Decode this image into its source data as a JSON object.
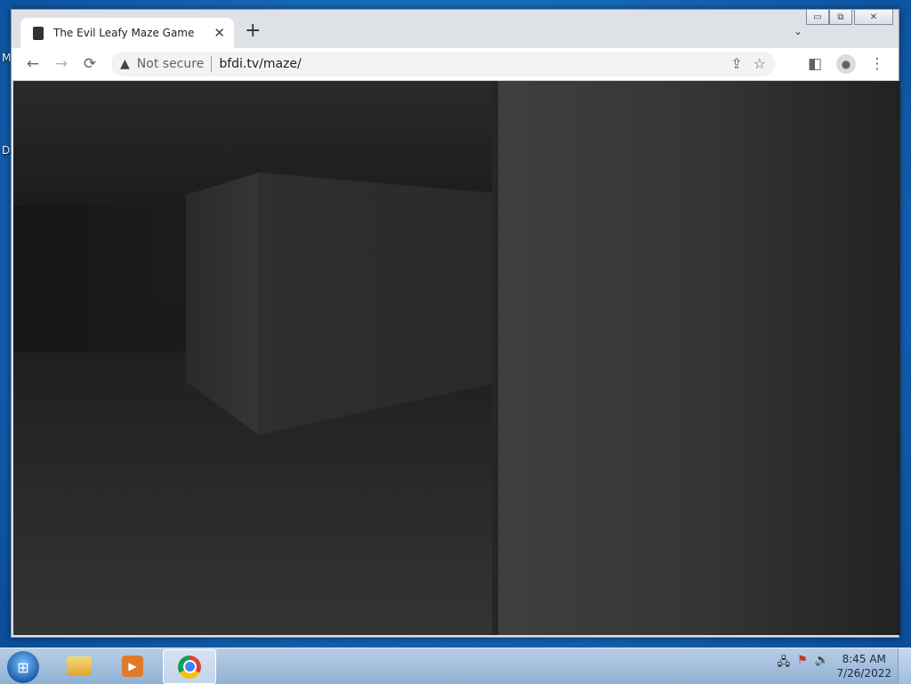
{
  "desktop": {
    "labels": [
      "M",
      "D"
    ]
  },
  "browser": {
    "tab": {
      "title": "The Evil Leafy Maze Game",
      "close": "✕"
    },
    "new_tab": "+",
    "tab_search": "⌄",
    "caption": {
      "minimize": "▭",
      "restore": "⧉",
      "close": "✕"
    },
    "nav": {
      "back": "←",
      "forward": "→",
      "reload": "⟳"
    },
    "omnibox": {
      "warning_icon": "▲",
      "security_label": "Not secure",
      "url": "bfdi.tv/maze/",
      "share": "⇪",
      "bookmark": "☆"
    },
    "sidepanel": "◧",
    "profile": "●",
    "menu": "⋮"
  },
  "taskbar": {
    "start": "⊞",
    "apps": [
      {
        "name": "windows-explorer",
        "active": false
      },
      {
        "name": "windows-media-player",
        "active": false,
        "glyph": "▶"
      },
      {
        "name": "google-chrome",
        "active": true
      }
    ],
    "tray": {
      "network": "🖧",
      "flag": "⚑",
      "volume": "🔊"
    },
    "clock": {
      "time": "8:45 AM",
      "date": "7/26/2022"
    }
  }
}
